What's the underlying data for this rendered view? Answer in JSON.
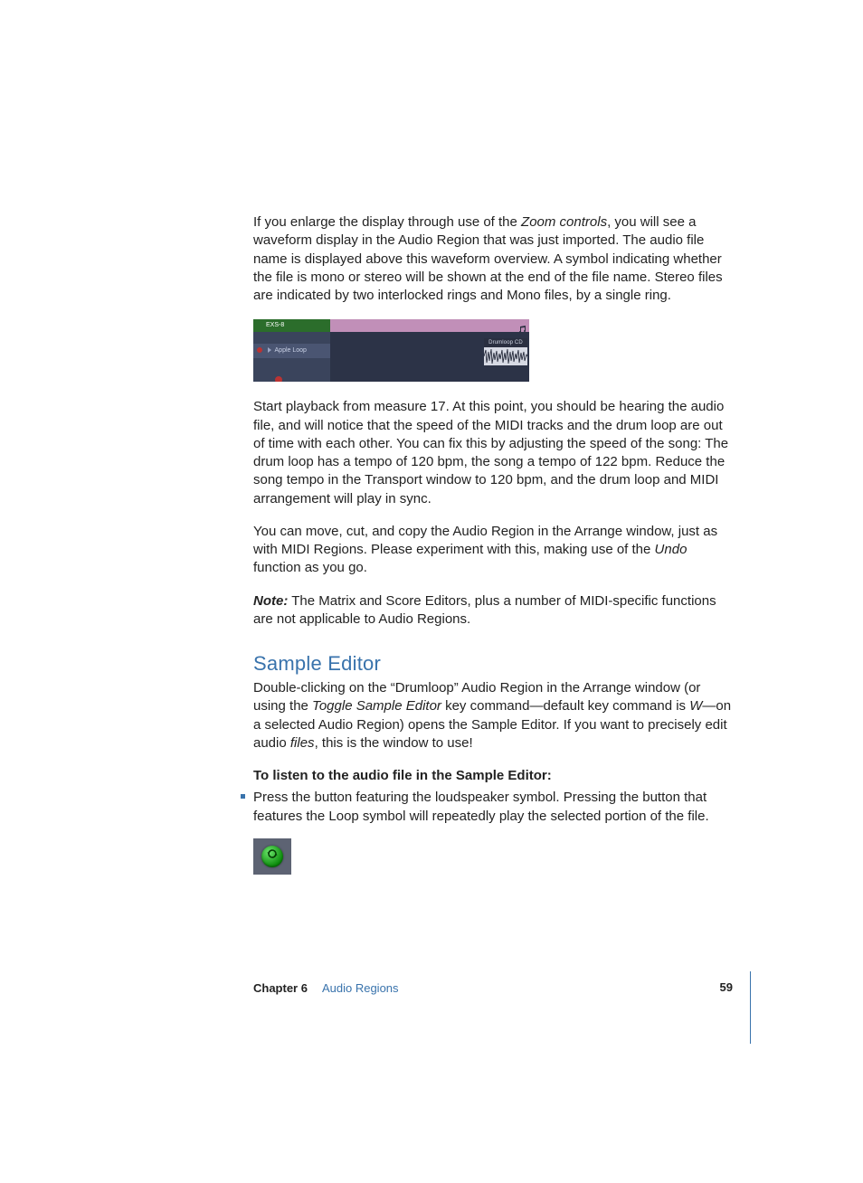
{
  "para1": {
    "a": "If you enlarge the display through use of the ",
    "ital1": "Zoom controls",
    "b": ", you will see a waveform display in the Audio Region that was just imported. The audio file name is displayed above this waveform overview. A symbol indicating whether the file is mono or stereo will be shown at the end of the file name. Stereo files are indicated by two interlocked rings and Mono files, by a single ring."
  },
  "fig1": {
    "green_label": "EXS-8",
    "track_label": "Apple Loop",
    "region_label": "Drumloop CD"
  },
  "para2": "Start playback from measure 17. At this point, you should be hearing the audio file, and will notice that the speed of the MIDI tracks and the drum loop are out of time with each other. You can fix this by adjusting the speed of the song:  The drum loop has a tempo of 120 bpm, the song a tempo of 122 bpm. Reduce the song tempo in the Transport window to 120 bpm, and the drum loop and MIDI arrangement will play in sync.",
  "para3": {
    "a": "You can move, cut, and copy the Audio Region in the Arrange window, just as with MIDI Regions. Please experiment with this, making use of the ",
    "ital1": "Undo",
    "b": " function as you go."
  },
  "note": {
    "label": "Note:",
    "text": "  The Matrix and Score Editors, plus a number of MIDI-specific functions are not applicable to Audio Regions."
  },
  "heading": "Sample Editor",
  "para4": {
    "a": "Double-clicking on the “Drumloop” Audio Region in the Arrange window (or using the ",
    "ital1": "Toggle Sample Editor",
    "b": " key command—default key command is ",
    "ital2": "W",
    "c": "—on a selected Audio Region) opens the Sample Editor. If you want to precisely edit audio ",
    "ital3": "files",
    "d": ", this is the window to use!"
  },
  "instr_heading": "To listen to the audio file in the Sample Editor:",
  "bullet1": "Press the button featuring the loudspeaker symbol. Pressing the button that features the Loop symbol will repeatedly play the selected portion of the file.",
  "footer": {
    "chapter_label": "Chapter 6",
    "chapter_title": "Audio Regions",
    "page_number": "59"
  }
}
